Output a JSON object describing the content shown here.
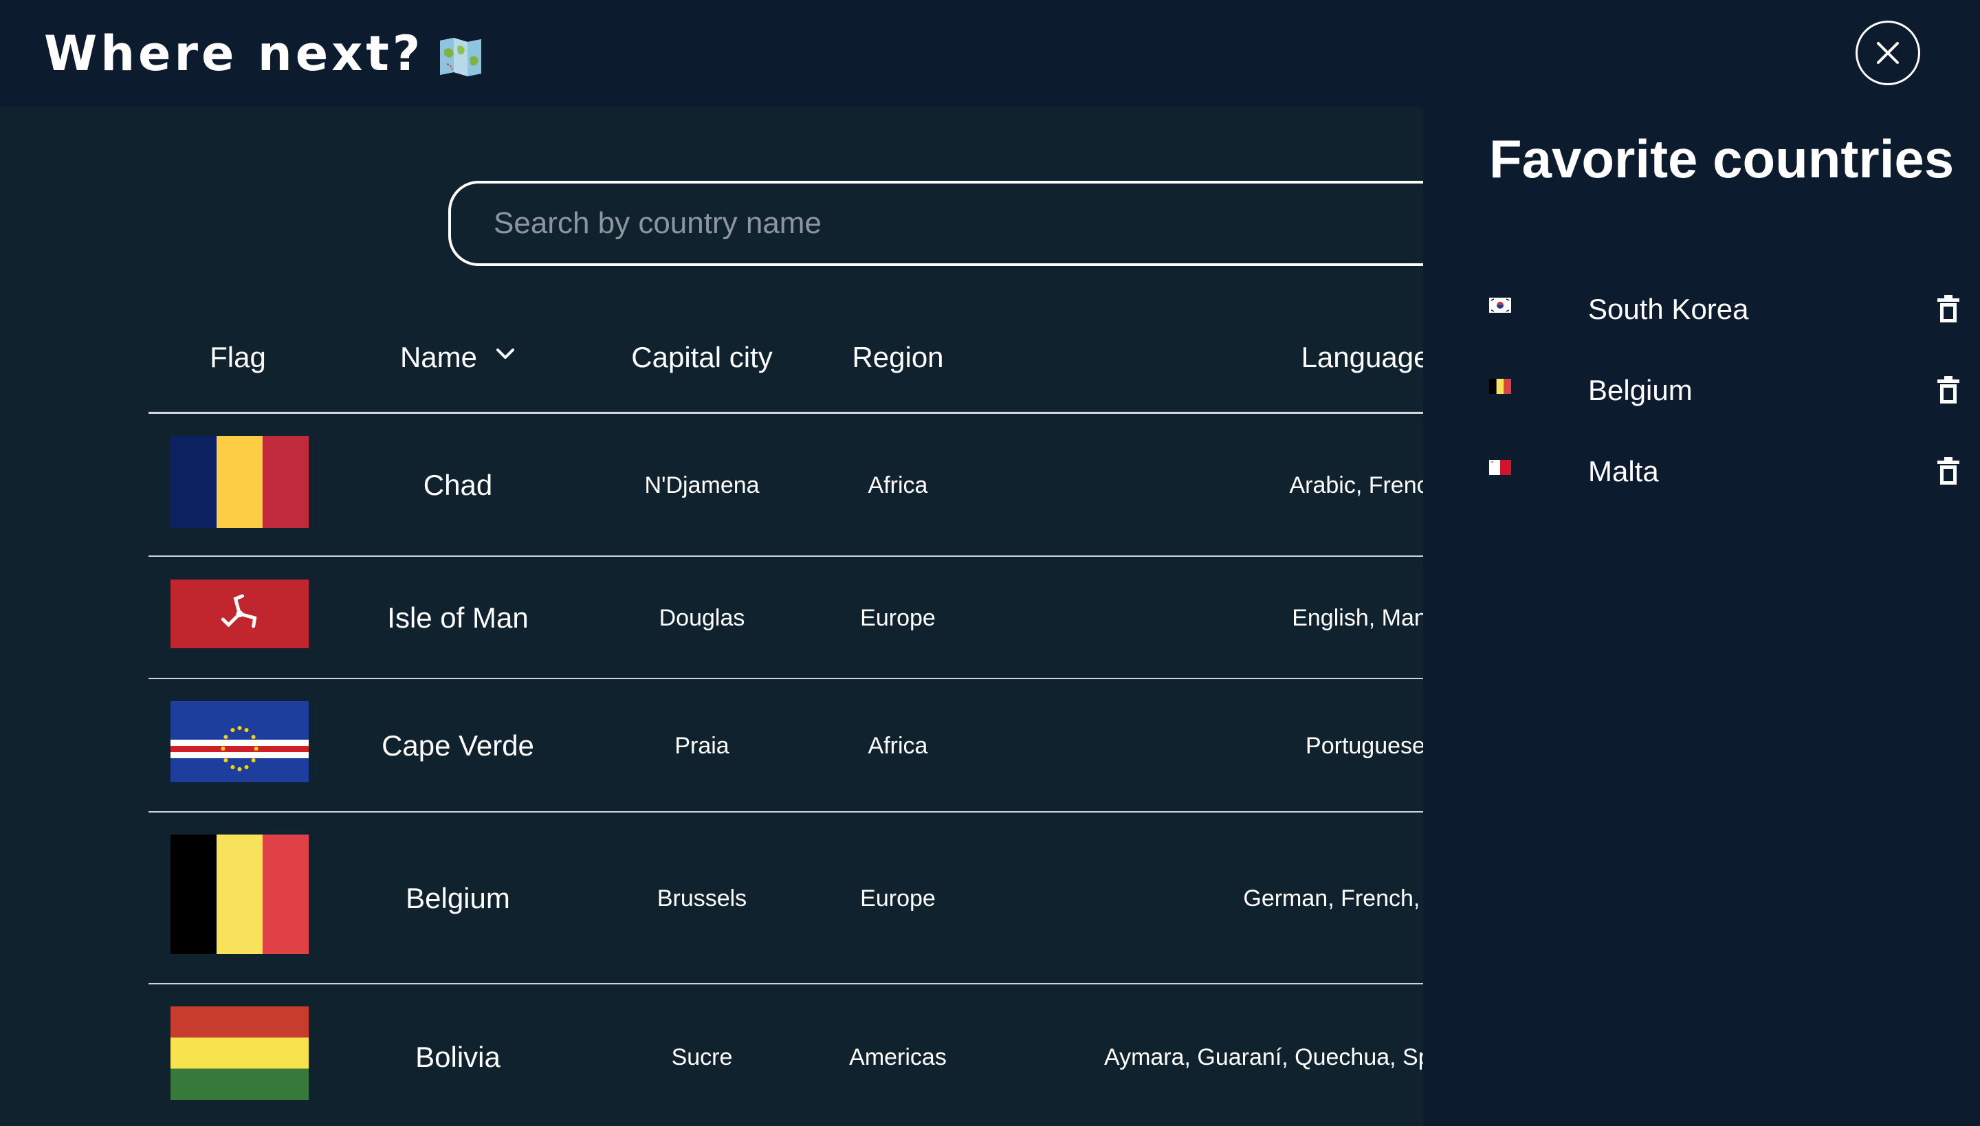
{
  "header": {
    "title": "Where next?",
    "title_icon": "folded-map-icon",
    "close_icon": "close-icon"
  },
  "search": {
    "placeholder": "Search by country name",
    "value": ""
  },
  "table": {
    "columns": [
      "Flag",
      "Name",
      "Capital city",
      "Region",
      "Language"
    ],
    "sort_icon": "chevron-down-icon",
    "rows": [
      {
        "flag": "chad-flag",
        "name": "Chad",
        "capital": "N'Djamena",
        "region": "Africa",
        "language": "Arabic, French"
      },
      {
        "flag": "isle-of-man-flag",
        "name": "Isle of Man",
        "capital": "Douglas",
        "region": "Europe",
        "language": "English, Manx"
      },
      {
        "flag": "cape-verde-flag",
        "name": "Cape Verde",
        "capital": "Praia",
        "region": "Africa",
        "language": "Portuguese"
      },
      {
        "flag": "belgium-flag",
        "name": "Belgium",
        "capital": "Brussels",
        "region": "Europe",
        "language": "German, French, Dutch"
      },
      {
        "flag": "bolivia-flag",
        "name": "Bolivia",
        "capital": "Sucre",
        "region": "Americas",
        "language": "Aymara, Guaraní, Quechua, Spar"
      }
    ]
  },
  "favorites": {
    "title": "Favorite countries",
    "delete_icon": "trash-icon",
    "items": [
      {
        "flag": "south-korea-flag",
        "label": "South Korea"
      },
      {
        "flag": "belgium-flag",
        "label": "Belgium"
      },
      {
        "flag": "malta-flag",
        "label": "Malta"
      }
    ]
  },
  "colors": {
    "topbar_background": "#0c1b2e",
    "main_background": "#11222f",
    "panel_background": "#0c1b2e",
    "text": "#ffffff",
    "placeholder": "#8d969f"
  }
}
